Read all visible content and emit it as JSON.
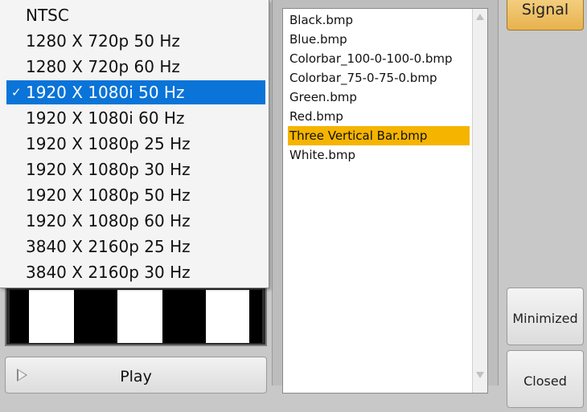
{
  "resolution_menu": {
    "items": [
      {
        "label": "NTSC",
        "selected": false
      },
      {
        "label": "1280 X 720p 50 Hz",
        "selected": false
      },
      {
        "label": "1280 X 720p 60 Hz",
        "selected": false
      },
      {
        "label": "1920 X 1080i 50 Hz",
        "selected": true
      },
      {
        "label": "1920 X 1080i 60 Hz",
        "selected": false
      },
      {
        "label": "1920 X 1080p 25 Hz",
        "selected": false
      },
      {
        "label": "1920 X 1080p 30 Hz",
        "selected": false
      },
      {
        "label": "1920 X 1080p 50 Hz",
        "selected": false
      },
      {
        "label": "1920 X 1080p 60 Hz",
        "selected": false
      },
      {
        "label": "3840 X 2160p 25 Hz",
        "selected": false
      },
      {
        "label": "3840 X 2160p 30 Hz",
        "selected": false
      }
    ],
    "check_mark": "✓"
  },
  "play_button": {
    "label": "Play",
    "icon": "play-icon"
  },
  "file_list": {
    "items": [
      {
        "label": "Black.bmp",
        "selected": false
      },
      {
        "label": "Blue.bmp",
        "selected": false
      },
      {
        "label": "Colorbar_100-0-100-0.bmp",
        "selected": false
      },
      {
        "label": "Colorbar_75-0-75-0.bmp",
        "selected": false
      },
      {
        "label": "Green.bmp",
        "selected": false
      },
      {
        "label": "Red.bmp",
        "selected": false
      },
      {
        "label": "Three Vertical Bar.bmp",
        "selected": true
      },
      {
        "label": "White.bmp",
        "selected": false
      }
    ]
  },
  "side_buttons": {
    "signal_label": "Signal",
    "minimized_label": "Minimized",
    "closed_label": "Closed"
  },
  "colors": {
    "menu_selected": "#0a74d8",
    "file_selected": "#f5b400",
    "signal_button": "#e8b24d"
  }
}
